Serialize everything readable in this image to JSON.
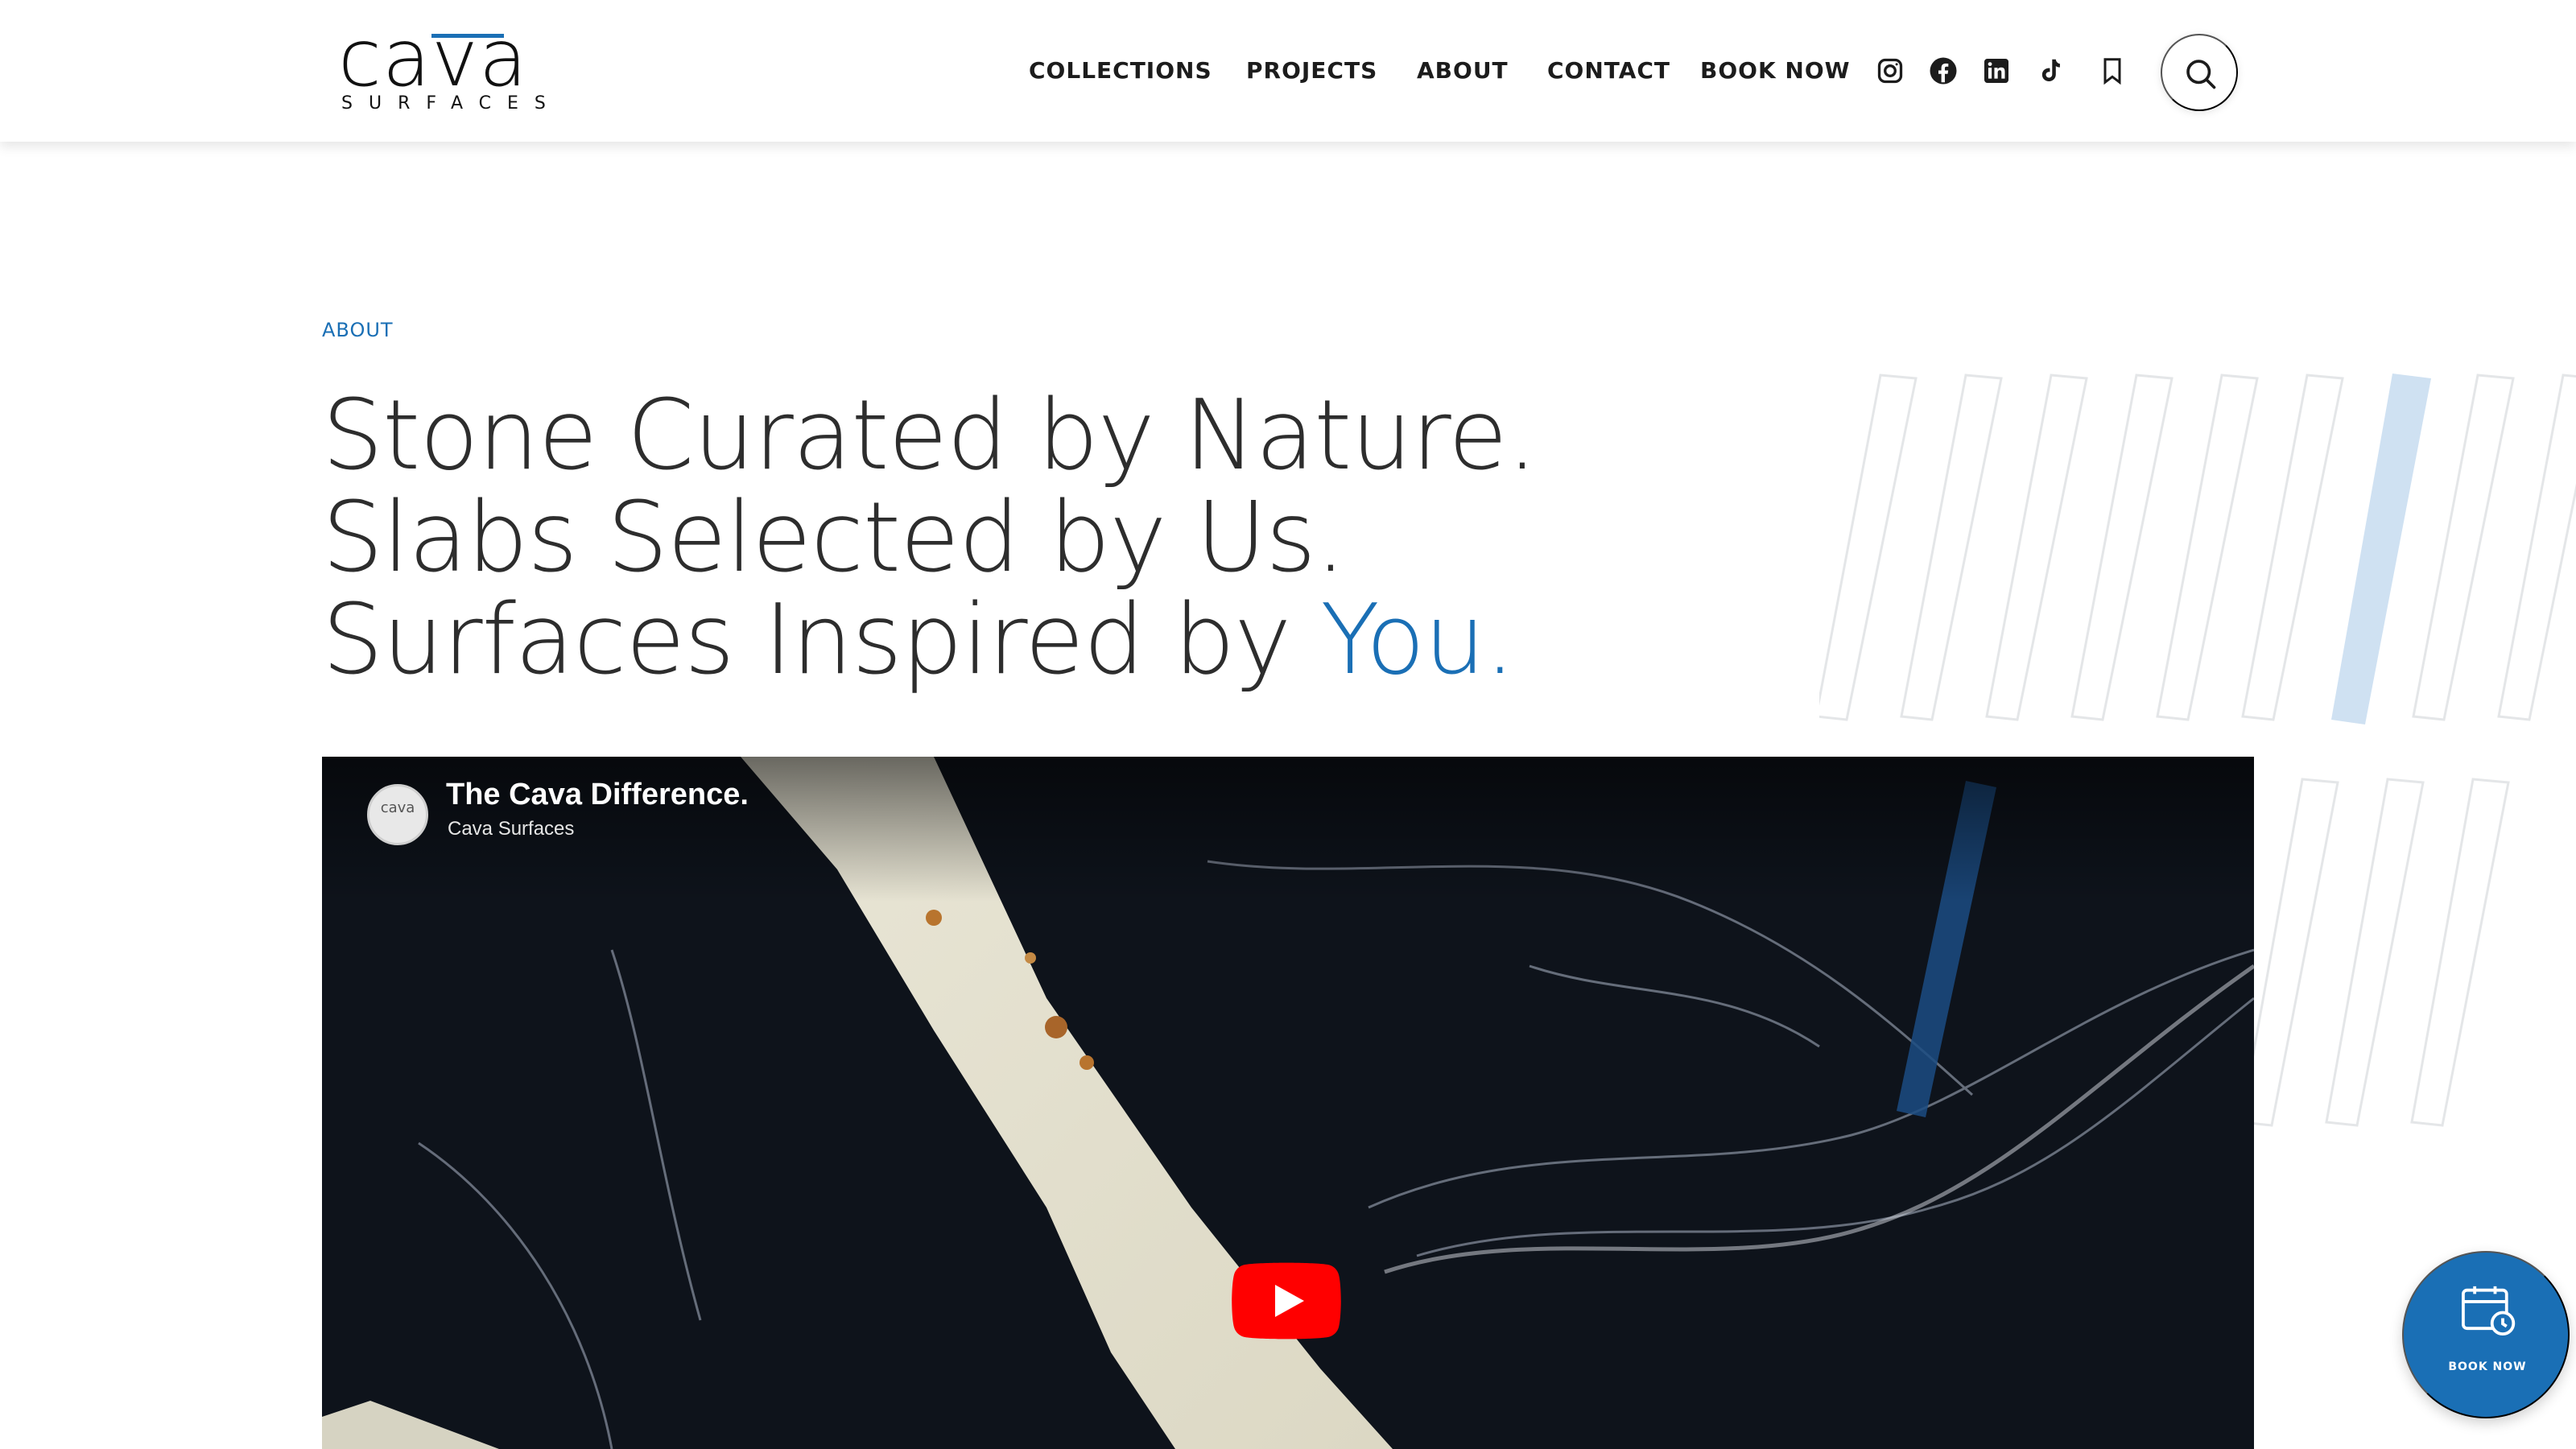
{
  "brand": {
    "logo_word": "cava",
    "logo_sub": "SURFACES",
    "accent_color": "#1a6fb5"
  },
  "nav": {
    "items": [
      {
        "label": "COLLECTIONS"
      },
      {
        "label": "PROJECTS"
      },
      {
        "label": "ABOUT"
      },
      {
        "label": "CONTACT"
      },
      {
        "label": "BOOK NOW"
      }
    ],
    "social_icons": [
      "instagram-icon",
      "facebook-icon",
      "linkedin-icon",
      "tiktok-icon",
      "bookmark-icon"
    ],
    "search_icon": "search-icon"
  },
  "hero": {
    "eyebrow": "ABOUT",
    "line1": "Stone Curated by Nature.",
    "line2": "Slabs Selected by Us.",
    "line3_prefix": "Surfaces Inspired by ",
    "line3_accent": "You."
  },
  "video": {
    "title": "The Cava Difference.",
    "channel": "Cava Surfaces",
    "avatar_text": "cava",
    "play_icon": "youtube-play-icon"
  },
  "fab": {
    "label": "BOOK NOW",
    "icon": "calendar-clock-icon"
  }
}
